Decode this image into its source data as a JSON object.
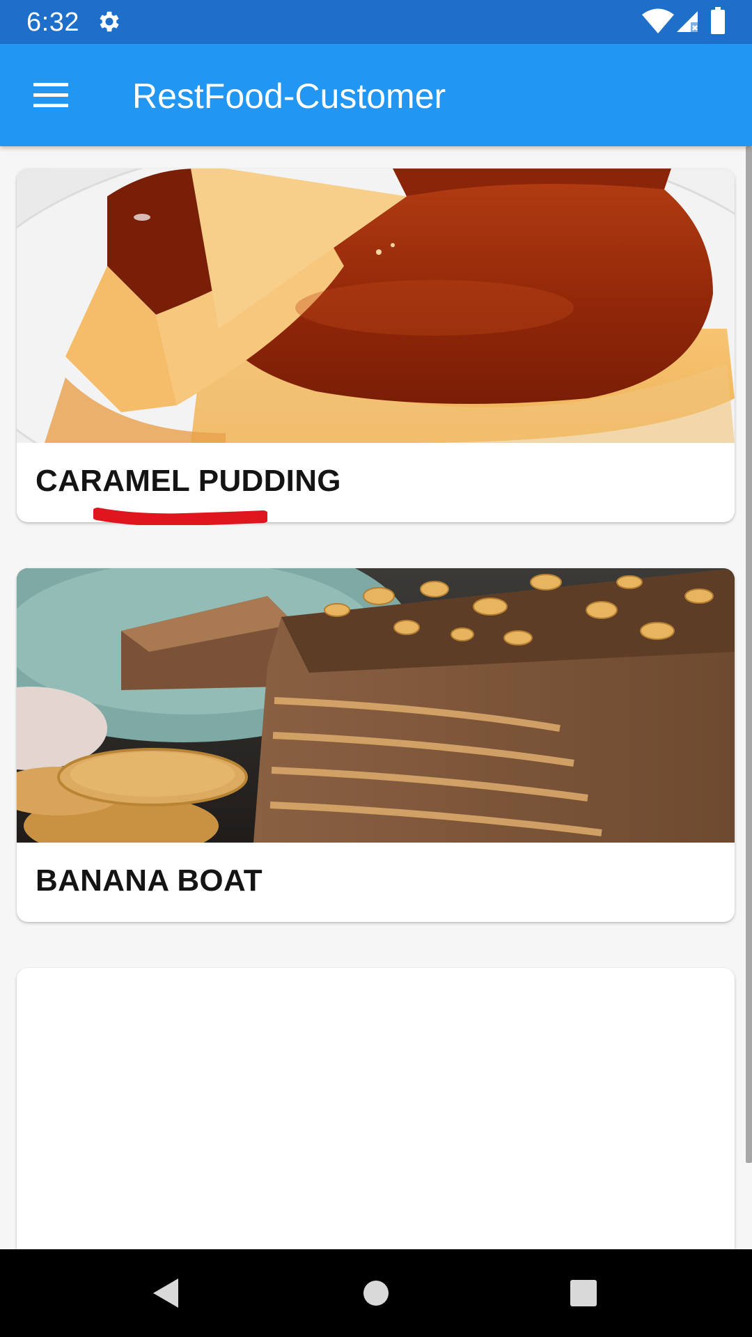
{
  "status_bar": {
    "time": "6:32",
    "icons": [
      "gear-icon",
      "wifi-icon",
      "signal-icon",
      "battery-icon"
    ]
  },
  "app_bar": {
    "title": "RestFood-Customer",
    "menu_icon": "hamburger-menu-icon",
    "color": "#2196f3"
  },
  "menu_items": [
    {
      "name": "CARAMEL PUDDING",
      "image": "caramel-pudding-photo",
      "highlighted": true,
      "highlight_color": "#e0161e"
    },
    {
      "name": "BANANA BOAT",
      "image": "biscuit-chocolate-cake-photo"
    },
    {
      "name": "",
      "image": ""
    }
  ],
  "nav_bar": {
    "buttons": [
      "back-icon",
      "home-icon",
      "recents-icon"
    ]
  }
}
